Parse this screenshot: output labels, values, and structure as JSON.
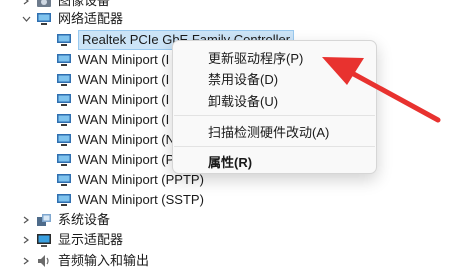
{
  "tree": {
    "partial_top_label": "图像设备",
    "network_adapters_label": "网络适配器",
    "selected_adapter": "Realtek PCIe GbE Family Controller",
    "wan_items": [
      "WAN Miniport (I",
      "WAN Miniport (I",
      "WAN Miniport (I",
      "WAN Miniport (I",
      "WAN Miniport (N",
      "WAN Miniport (P",
      "WAN Miniport (PPTP)",
      "WAN Miniport (SSTP)"
    ],
    "system_devices_label": "系统设备",
    "display_adapters_label": "显示适配器",
    "audio_label": "音频输入和输出"
  },
  "context_menu": {
    "update_driver": "更新驱动程序(P)",
    "disable_device": "禁用设备(D)",
    "uninstall_device": "卸载设备(U)",
    "scan_hardware": "扫描检测硬件改动(A)",
    "properties": "属性(R)"
  },
  "colors": {
    "selection_bg": "#cce4f7",
    "selection_border": "#99c9ef",
    "arrow": "#e8322f"
  }
}
